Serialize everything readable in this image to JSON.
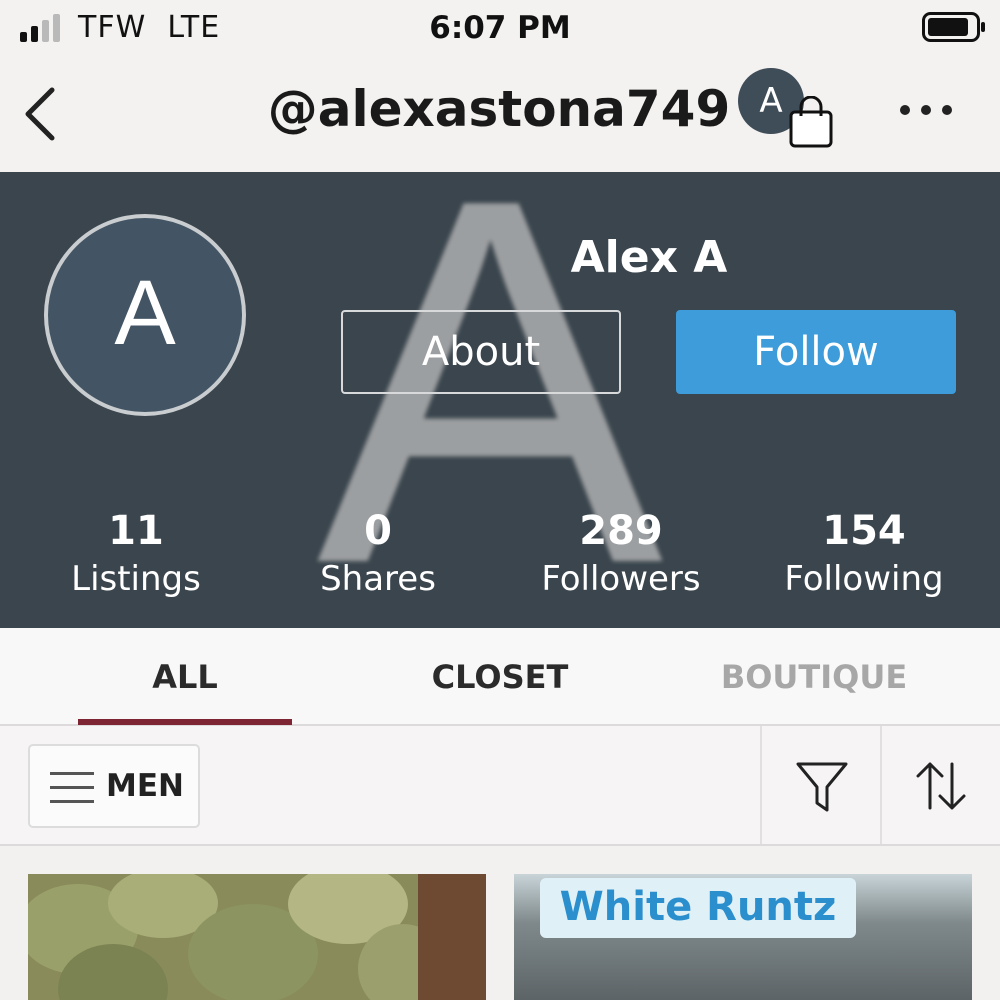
{
  "status_bar": {
    "carrier": "TFW",
    "network": "LTE",
    "time": "6:07 PM",
    "signal_bars": 2,
    "battery_level": 0.8
  },
  "nav": {
    "handle": "@alexastona749",
    "avatar_initial": "A",
    "icons": [
      "back-chevron-icon",
      "shopping-bag-icon",
      "more-icon"
    ]
  },
  "profile": {
    "display_name": "Alex A",
    "avatar_initial": "A",
    "cover_initial": "A",
    "about_label": "About",
    "follow_label": "Follow",
    "stats": [
      {
        "value": "11",
        "label": "Listings"
      },
      {
        "value": "0",
        "label": "Shares"
      },
      {
        "value": "289",
        "label": "Followers"
      },
      {
        "value": "154",
        "label": "Following"
      }
    ]
  },
  "tabs": [
    {
      "label": "ALL",
      "active": true
    },
    {
      "label": "CLOSET",
      "active": false
    },
    {
      "label": "BOUTIQUE",
      "active": false
    }
  ],
  "filter_bar": {
    "department": "MEN",
    "icons": [
      "hamburger-icon",
      "filter-icon",
      "sort-icon"
    ]
  },
  "listings": [
    {
      "image": "cannabis-buds-photo"
    },
    {
      "image": "container-photo",
      "sticker_text": "White Runtz"
    }
  ],
  "colors": {
    "header_bg": "#3a454d",
    "follow_button": "#3d9cd9",
    "active_tab_underline": "#7e2534",
    "avatar_bg": "#435564"
  }
}
